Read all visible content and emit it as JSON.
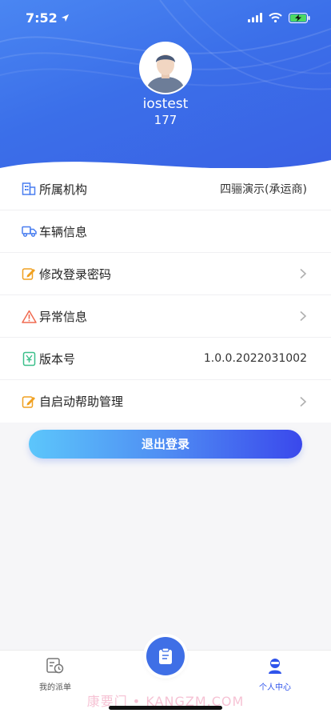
{
  "status_bar": {
    "time": "7:52"
  },
  "profile": {
    "username": "iostest",
    "user_id": "177"
  },
  "menu": [
    {
      "label": "所属机构",
      "value": "四骊演示(承运商)",
      "icon": "building-icon",
      "icon_color": "#4a7ff0",
      "chevron": false
    },
    {
      "label": "车辆信息",
      "value": "",
      "icon": "truck-icon",
      "icon_color": "#4a7ff0",
      "chevron": false
    },
    {
      "label": "修改登录密码",
      "value": "",
      "icon": "edit-icon",
      "icon_color": "#f0a020",
      "chevron": true
    },
    {
      "label": "异常信息",
      "value": "",
      "icon": "warning-icon",
      "icon_color": "#f06a50",
      "chevron": true
    },
    {
      "label": "版本号",
      "value": "1.0.0.2022031002",
      "icon": "version-icon",
      "icon_color": "#3bbf8a",
      "chevron": false
    },
    {
      "label": "自启动帮助管理",
      "value": "",
      "icon": "edit-icon",
      "icon_color": "#f0a020",
      "chevron": true
    }
  ],
  "logout_label": "退出登录",
  "tabbar": {
    "left_label": "我的派单",
    "right_label": "个人中心",
    "active_color": "#2f54eb"
  },
  "watermark": "康要门 • KANGZM.COM"
}
